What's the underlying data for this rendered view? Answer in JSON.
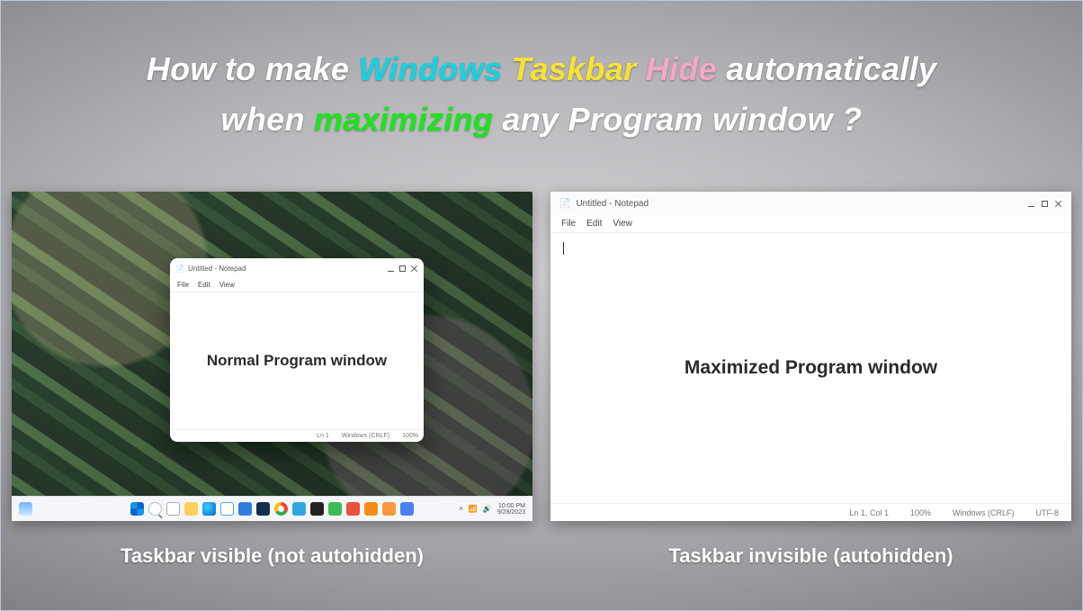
{
  "title": {
    "p1": "How to make ",
    "w_windows": "Windows",
    "sp1": " ",
    "w_taskbar": "Taskbar",
    "sp2": " ",
    "w_hide": "Hide",
    "p2": " automatically",
    "p3": "when ",
    "w_max": "maximizing",
    "p4": " any Program window ?"
  },
  "left": {
    "caption": "Taskbar visible (not autohidden)",
    "window": {
      "title": "Untitled - Notepad",
      "menus": [
        "File",
        "Edit",
        "View"
      ],
      "body": "Normal Program window",
      "status": [
        "Ln 1",
        "Windows (CRLF)",
        "100%"
      ]
    },
    "taskbar": {
      "widget_temp": "",
      "clock_time": "10:00 PM",
      "clock_date": "9/28/2023"
    }
  },
  "right": {
    "caption": "Taskbar invisible (autohidden)",
    "window": {
      "title": "Untitled - Notepad",
      "menus": [
        "File",
        "Edit",
        "View"
      ],
      "body": "Maximized Program window",
      "status": [
        "Ln 1, Col 1",
        "100%",
        "Windows (CRLF)",
        "UTF-8"
      ]
    }
  }
}
